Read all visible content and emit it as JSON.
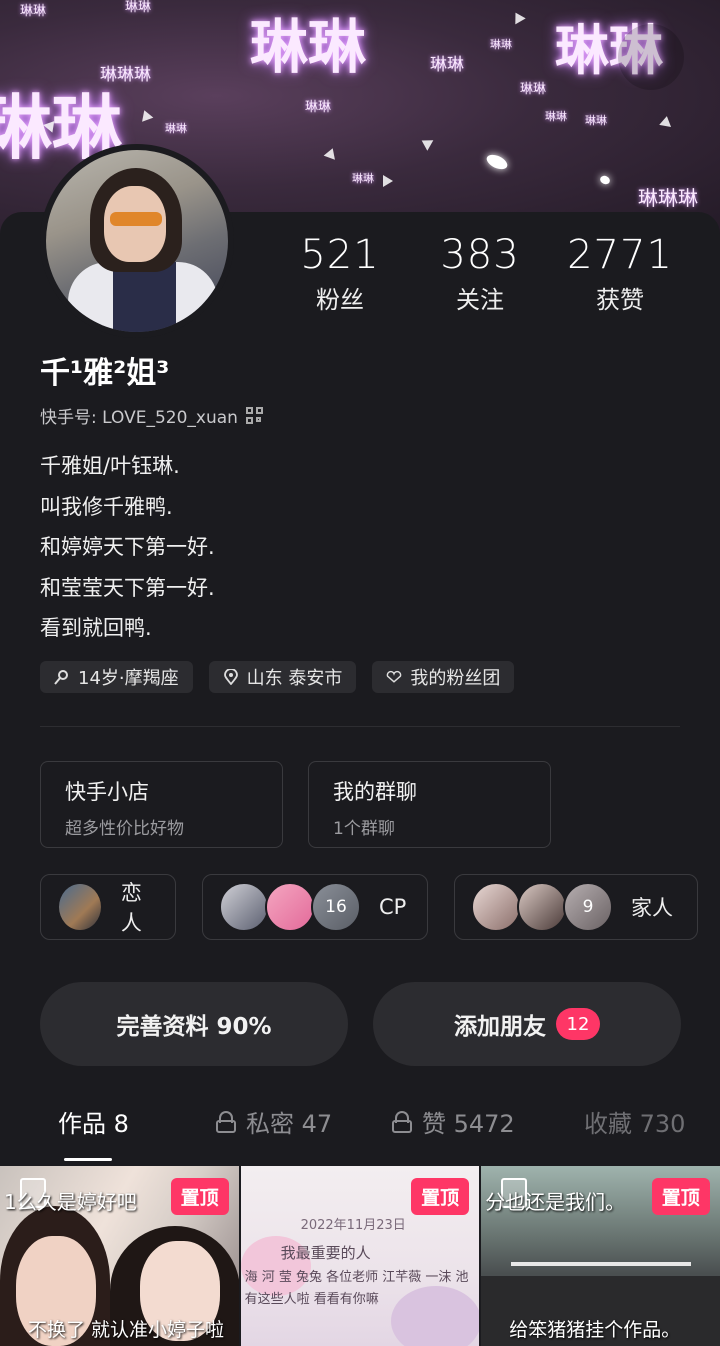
{
  "banner": {
    "words_big": [
      "琳琳",
      "琳琳",
      "琳琳"
    ],
    "words_small": [
      "琳琳",
      "琳琳",
      "琳琳琳",
      "琳琳",
      "琳琳",
      "琳琳",
      "琳琳",
      "琳琳",
      "琳琳",
      "琳琳",
      "琳琳",
      "琳琳琳"
    ],
    "accent_color": "#c77dff"
  },
  "profile": {
    "name": "千¹雅²姐³",
    "kuaishou_id": "快手号: LOVE_520_xuan",
    "bio": [
      "千雅姐/叶钰琳.",
      "叫我修千雅鸭.",
      "和婷婷天下第一好.",
      "和莹莹天下第一好.",
      "看到就回鸭."
    ],
    "tags": [
      {
        "icon": "zodiac-icon",
        "label": "14岁·摩羯座"
      },
      {
        "icon": "location-pin-icon",
        "label": "山东 泰安市"
      },
      {
        "icon": "heart-icon",
        "label": "我的粉丝团"
      }
    ]
  },
  "stats": [
    {
      "value": "521",
      "label": "粉丝"
    },
    {
      "value": "383",
      "label": "关注"
    },
    {
      "value": "2771",
      "label": "获赞"
    }
  ],
  "shop": {
    "title": "快手小店",
    "subtitle": "超多性价比好物"
  },
  "group_chat": {
    "title": "我的群聊",
    "subtitle": "1个群聊"
  },
  "relations": [
    {
      "label": "恋人",
      "count": ""
    },
    {
      "label": "CP",
      "count": "16"
    },
    {
      "label": "家人",
      "count": "9"
    }
  ],
  "actions": {
    "complete_profile": "完善资料 90%",
    "add_friend": "添加朋友",
    "add_friend_badge": "12"
  },
  "tabs": [
    {
      "label": "作品 8",
      "locked": false
    },
    {
      "label": "私密 47",
      "locked": true
    },
    {
      "label": "赞 5472",
      "locked": true
    },
    {
      "label": "收藏 730",
      "locked": false
    }
  ],
  "posts": [
    {
      "pin": "置顶",
      "top_text": "1么久是婷好吧",
      "bottom_text": "不换了 就认准小婷子啦"
    },
    {
      "pin": "置顶",
      "lines": [
        "2022年11月23日",
        "我最重要的人",
        "海 河 莹 兔兔 各位老师 江芊薇 一沫 池",
        "有这些人啦 看看有你嘛"
      ]
    },
    {
      "pin": "置顶",
      "top_text": "分也还是我们。",
      "bottom_text": "给笨猪猪挂个作品。"
    }
  ]
}
